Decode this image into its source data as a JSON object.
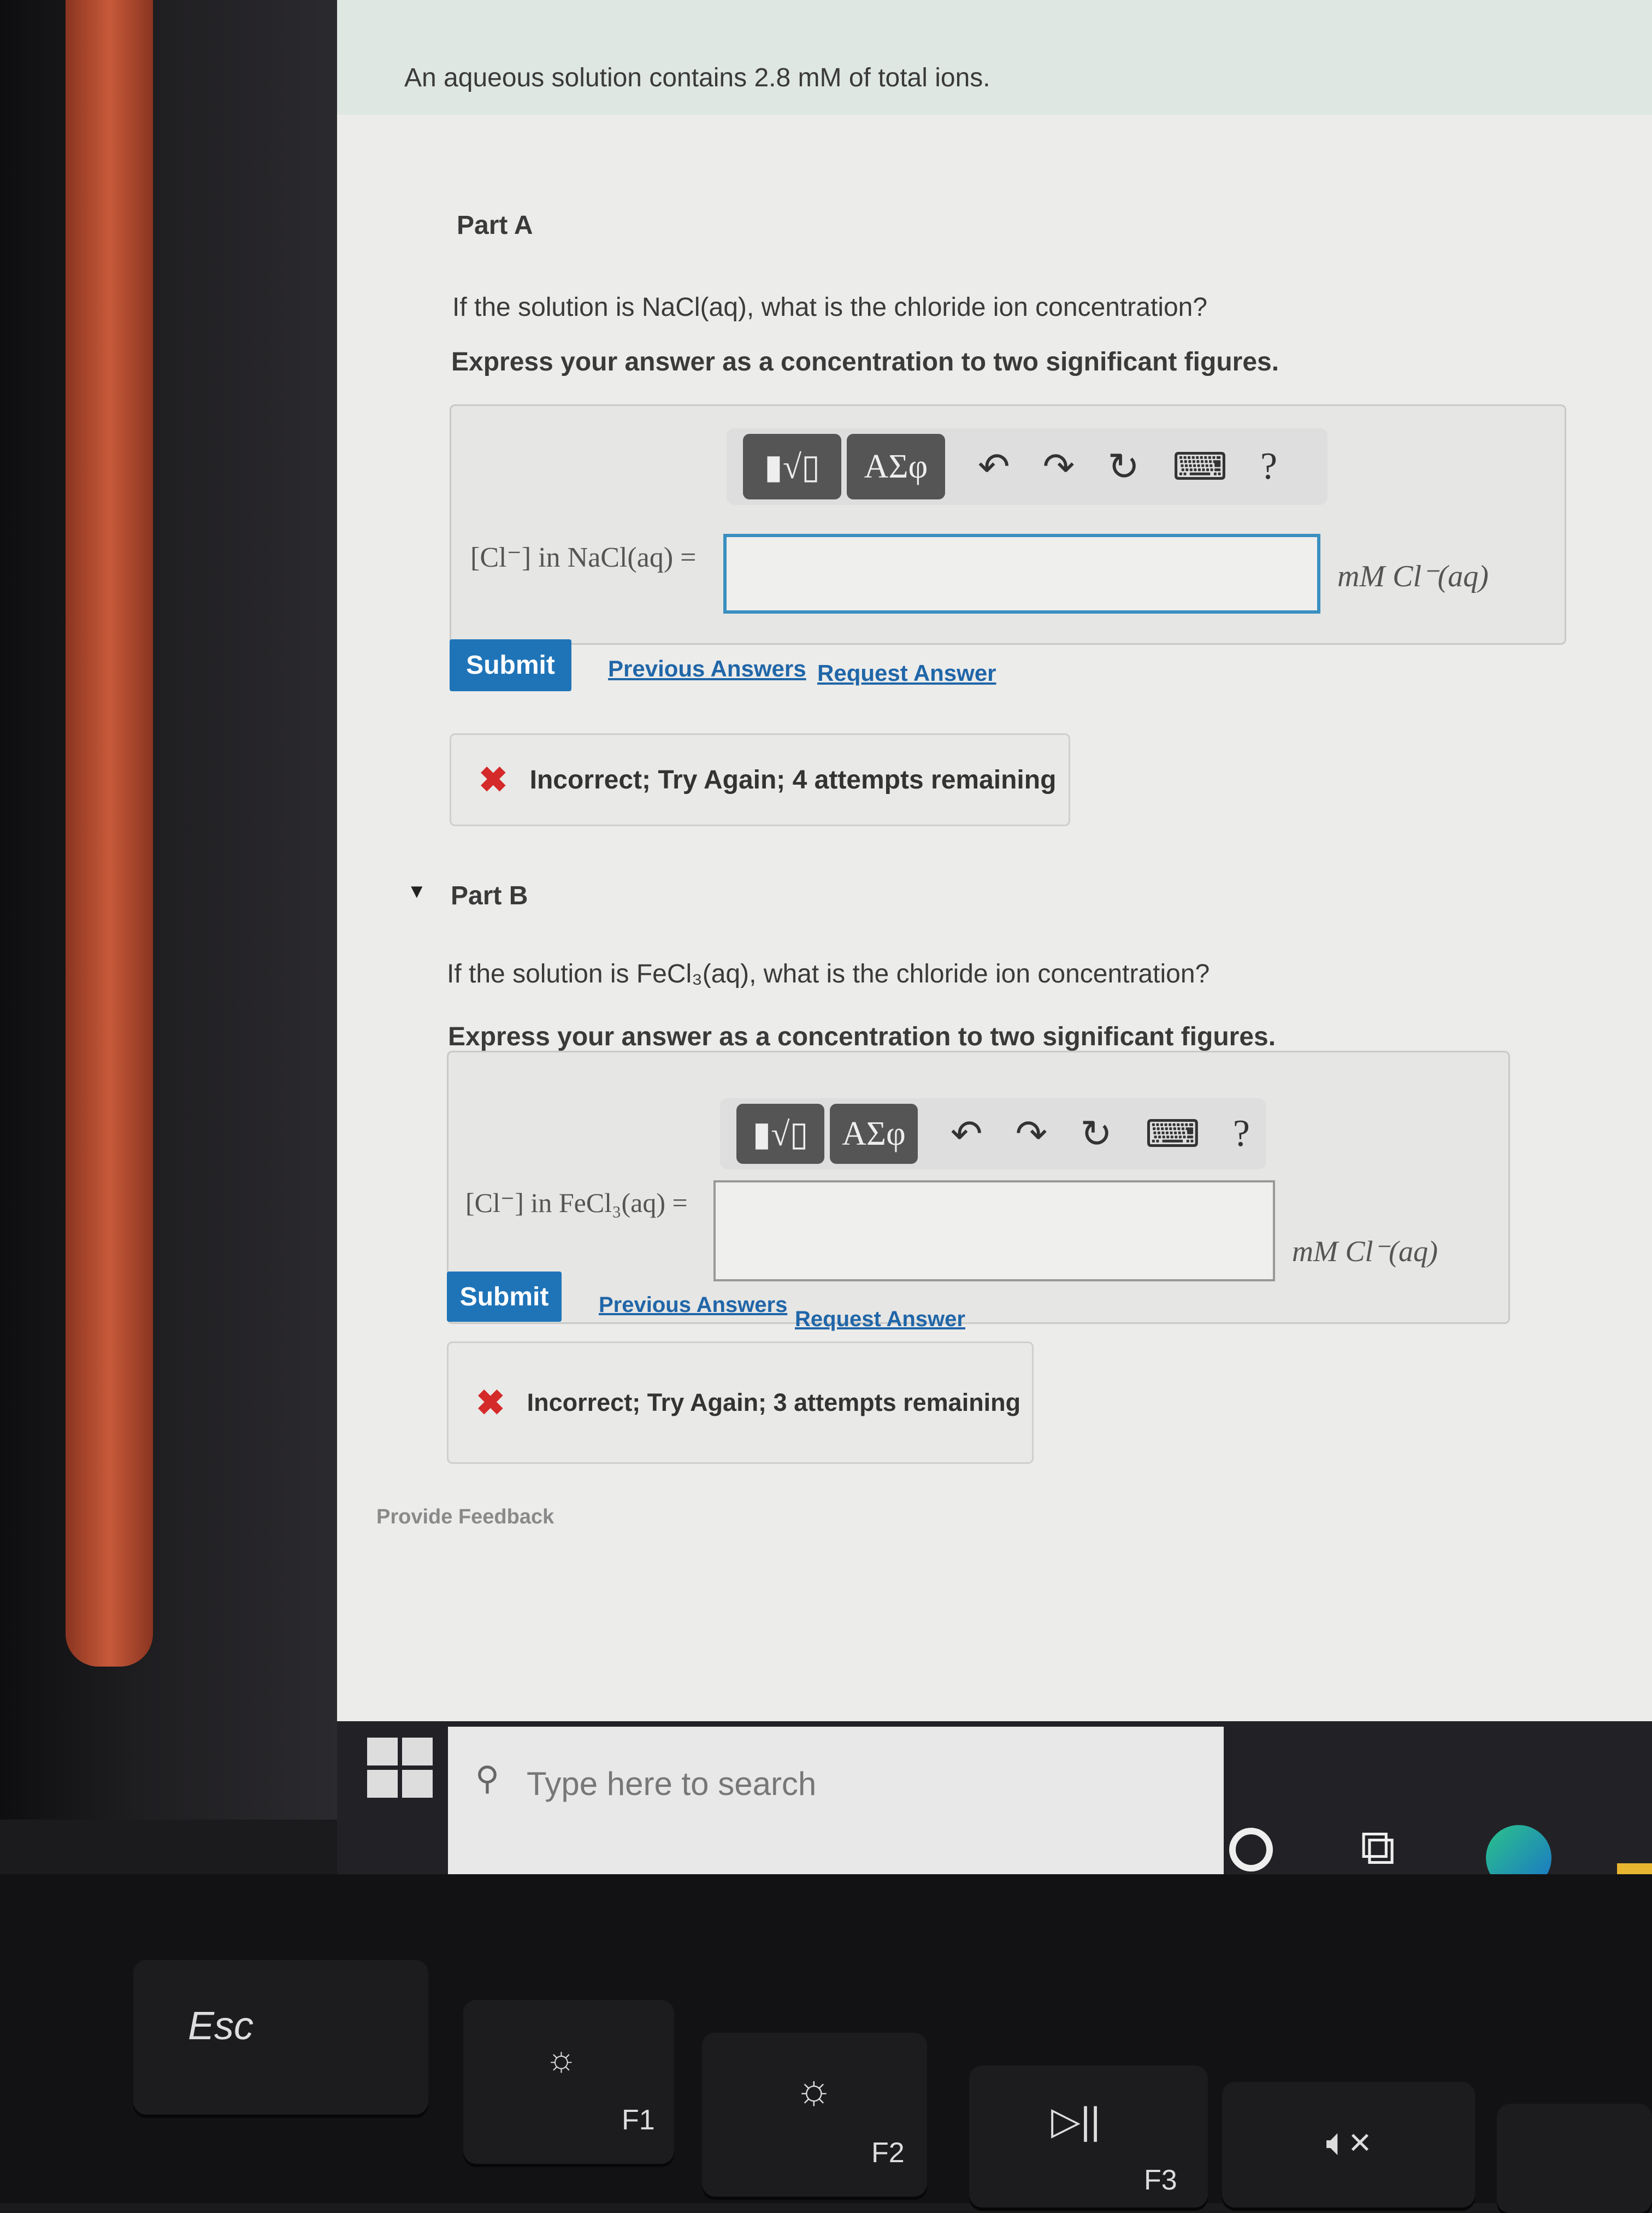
{
  "intro": "An aqueous solution contains 2.8 mM of total ions.",
  "toolbar": {
    "templates_icon": "▮√▯",
    "greek_label": "ΑΣφ",
    "undo_icon": "↶",
    "redo_icon": "↷",
    "reset_icon": "↻",
    "keyboard_icon": "⌨",
    "help_label": "?"
  },
  "partA": {
    "label": "Part A",
    "question": "If the solution is NaCl(aq), what is the chloride ion concentration?",
    "instruction": "Express your answer as a concentration to two significant figures.",
    "answer_label": "[Cl⁻] in NaCl(aq) =",
    "answer_value": "",
    "units": "mM Cl⁻(aq)",
    "submit": "Submit",
    "previous": "Previous Answers",
    "request": "Request Answer",
    "feedback": "Incorrect; Try Again; 4 attempts remaining"
  },
  "partB": {
    "label": "Part B",
    "question": "If the solution is FeCl₃(aq), what is the chloride ion concentration?",
    "instruction": "Express your answer as a concentration to two significant figures.",
    "answer_label": "[Cl⁻] in FeCl₃(aq) =",
    "answer_value": "",
    "units": "mM Cl⁻(aq)",
    "submit": "Submit",
    "previous": "Previous Answers",
    "request": "Request Answer",
    "feedback": "Incorrect; Try Again; 3 attempts remaining"
  },
  "provide_feedback": "Provide Feedback",
  "taskbar": {
    "search_placeholder": "Type here to search"
  },
  "keys": {
    "esc": "Esc",
    "f1": "F1",
    "f2": "F2",
    "f3": "F3"
  },
  "colors": {
    "submit": "#1f74b8",
    "link": "#2066a8",
    "error": "#d42a2a",
    "focus": "#3a8fc0"
  }
}
